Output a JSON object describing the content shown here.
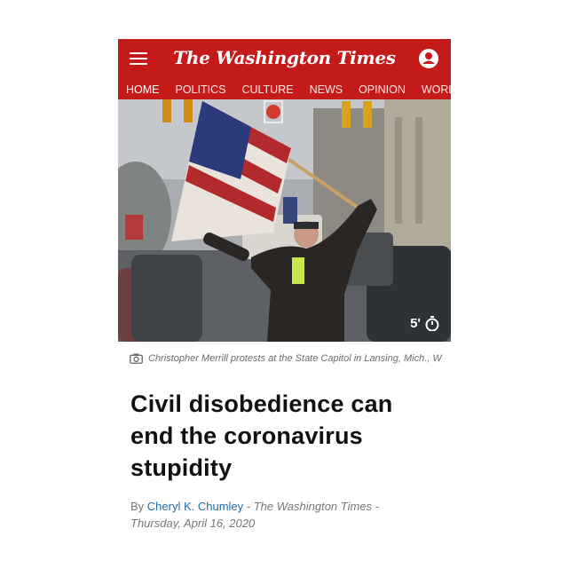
{
  "header": {
    "masthead": "The Washington Times",
    "nav": [
      "HOME",
      "POLITICS",
      "CULTURE",
      "NEWS",
      "OPINION",
      "WORLD"
    ],
    "active_nav": "HOME",
    "brand_color": "#c51a1a"
  },
  "hero": {
    "read_time": "5'",
    "icon": "stopwatch-icon"
  },
  "caption": {
    "icon": "camera-icon",
    "text": "Christopher Merrill protests at the State Capitol in Lansing, Mich., W"
  },
  "article": {
    "headline": "Civil disobedience can end the coronavirus stupidity",
    "byline_prefix": "By",
    "author": "Cheryl K. Chumley",
    "source": "- The Washington Times -",
    "date": "Thursday, April 16, 2020"
  }
}
